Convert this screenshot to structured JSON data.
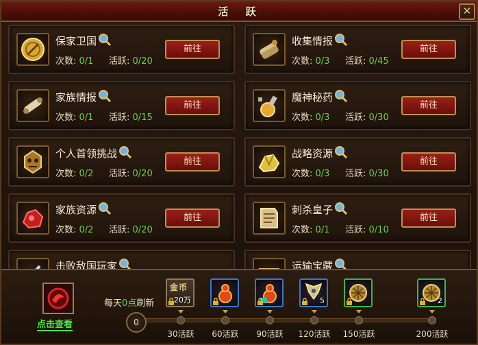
{
  "window": {
    "title": "活 跃",
    "close_icon": "close-icon"
  },
  "stat_labels": {
    "count": "次数:",
    "activity": "活跃:"
  },
  "tasks": [
    {
      "name": "保家卫国",
      "icon": "gold-medal-icon",
      "count": "0/1",
      "activity": "0/20",
      "button": "前往"
    },
    {
      "name": "收集情报",
      "icon": "scroll-bundle-icon",
      "count": "0/3",
      "activity": "0/45",
      "button": "前往"
    },
    {
      "name": "家族情报",
      "icon": "scroll-icon",
      "count": "0/1",
      "activity": "0/15",
      "button": "前往"
    },
    {
      "name": "魔神秘药",
      "icon": "potion-bottle-icon",
      "count": "0/3",
      "activity": "0/30",
      "button": "前往"
    },
    {
      "name": "个人首领挑战",
      "icon": "demon-mask-icon",
      "count": "0/2",
      "activity": "0/20",
      "button": "前往"
    },
    {
      "name": "战略资源",
      "icon": "gold-ore-icon",
      "count": "0/3",
      "activity": "0/30",
      "button": "前往"
    },
    {
      "name": "家族资源",
      "icon": "red-ore-icon",
      "count": "0/2",
      "activity": "0/20",
      "button": "前往"
    },
    {
      "name": "刺杀皇子",
      "icon": "document-icon",
      "count": "0/1",
      "activity": "0/10",
      "button": "前往"
    },
    {
      "name": "击败敌国玩家",
      "icon": "sword-icon"
    },
    {
      "name": "运输宝藏",
      "icon": "cart-icon"
    }
  ],
  "bottom": {
    "check_label": "点击查看",
    "refresh_prefix": "每天",
    "refresh_highlight": "0点",
    "refresh_suffix": "刷新",
    "current_activity": "0",
    "milestones": [
      {
        "label": "30活跃",
        "reward": "gold-coin-icon",
        "reward_text": "金币",
        "count": "20万",
        "frame": "gold"
      },
      {
        "label": "60活跃",
        "reward": "gourd-potion-icon",
        "count": "",
        "frame": "blue"
      },
      {
        "label": "90活跃",
        "reward": "gourd-potion-icon",
        "count": "",
        "frame": "blue"
      },
      {
        "label": "120活跃",
        "reward": "wings-emblem-icon",
        "count": "5",
        "frame": "blue"
      },
      {
        "label": "150活跃",
        "reward": "treasure-ball-icon",
        "count": "",
        "frame": "green"
      },
      {
        "label": "200活跃",
        "reward": "treasure-ball-icon",
        "count": "2",
        "frame": "green"
      }
    ]
  },
  "colors": {
    "accent_green": "#6ed24a",
    "button_red": "#9a1e18",
    "frame_gold": "#c09050"
  }
}
